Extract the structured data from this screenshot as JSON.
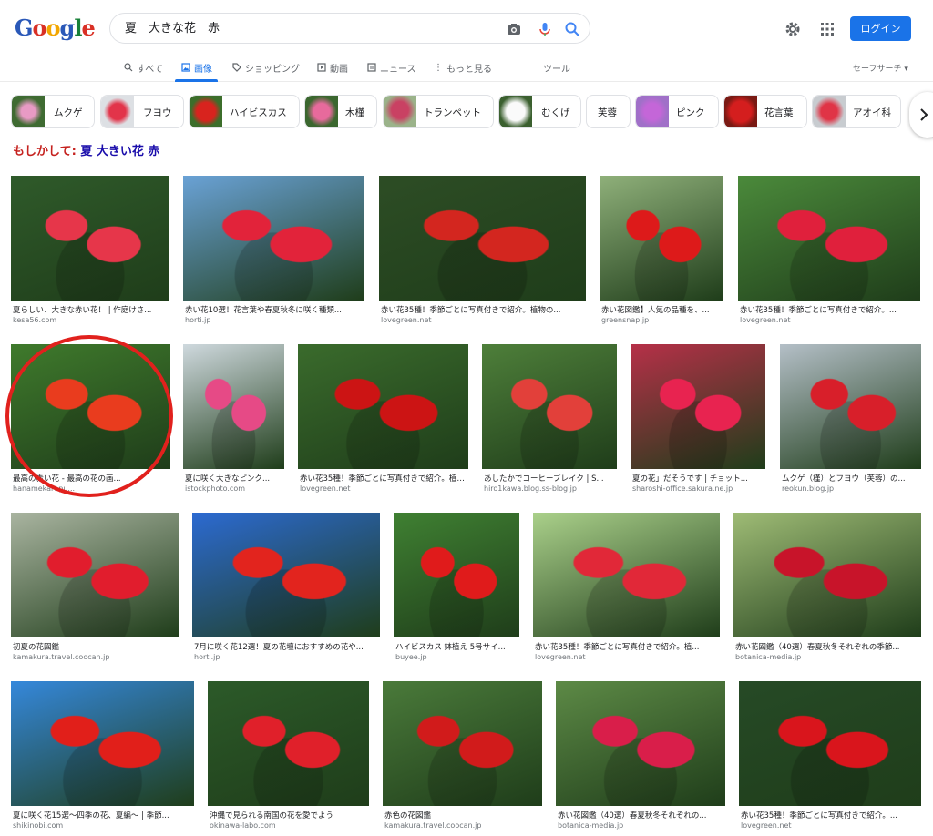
{
  "header": {
    "logo_text": "Google",
    "search_query": "夏　大きな花　赤",
    "login_label": "ログイン"
  },
  "tabs": [
    {
      "label": "すべて",
      "icon": "search-icon"
    },
    {
      "label": "画像",
      "icon": "image-icon",
      "active": true
    },
    {
      "label": "ショッピング",
      "icon": "tag-icon"
    },
    {
      "label": "動画",
      "icon": "play-icon"
    },
    {
      "label": "ニュース",
      "icon": "news-icon"
    },
    {
      "label": "もっと見る",
      "icon": "more-icon"
    }
  ],
  "tools_label": "ツール",
  "safesearch_label": "セーフサーチ ▾",
  "chips": [
    {
      "label": "ムクゲ",
      "has_thumb": true
    },
    {
      "label": "フヨウ",
      "has_thumb": true
    },
    {
      "label": "ハイビスカス",
      "has_thumb": true
    },
    {
      "label": "木槿",
      "has_thumb": true
    },
    {
      "label": "トランペット",
      "has_thumb": true
    },
    {
      "label": "むくげ",
      "has_thumb": true
    },
    {
      "label": "芙蓉",
      "has_thumb": false
    },
    {
      "label": "ピンク",
      "has_thumb": true
    },
    {
      "label": "花言葉",
      "has_thumb": true
    },
    {
      "label": "アオイ科",
      "has_thumb": true
    }
  ],
  "did_you_mean": {
    "prefix": "もしかして: ",
    "suggestion": "夏 大きい花 赤"
  },
  "results": [
    {
      "caption": "夏らしい、大きな赤い花！ | 作庭けさ...",
      "source": "kesa56.com",
      "bg": "#2f5a2a",
      "flower": "#e6364a"
    },
    {
      "caption": "赤い花10選！花言葉や春夏秋冬に咲く種類...",
      "source": "horti.jp",
      "bg": "#6aa2d6",
      "flower": "#e2233a"
    },
    {
      "caption": "赤い花35種！季節ごとに写真付きで紹介。植物の...",
      "source": "lovegreen.net",
      "bg": "#2d4d25",
      "flower": "#d3261f"
    },
    {
      "caption": "赤い花図鑑】人気の品種を、...",
      "source": "greensnap.jp",
      "bg": "#8fb07a",
      "flower": "#dd1a1a"
    },
    {
      "caption": "赤い花35種！季節ごとに写真付きで紹介。...",
      "source": "lovegreen.net",
      "bg": "#4b8a3b",
      "flower": "#e0203c"
    },
    {
      "caption": "最高の赤い花 - 最高の花の画...",
      "source": "hanamekarapu...",
      "bg": "#3f7a2c",
      "flower": "#e93c1e"
    },
    {
      "caption": "夏に咲く大きなピンク...",
      "source": "istockphoto.com",
      "bg": "#cfd9de",
      "flower": "#e64a86"
    },
    {
      "caption": "赤い花35種！季節ごとに写真付きで紹介。植物の...",
      "source": "lovegreen.net",
      "bg": "#3a6b2c",
      "flower": "#cc1414"
    },
    {
      "caption": "あしたかでコーヒーブレイク | S...",
      "source": "hiro1kawa.blog.ss-blog.jp",
      "bg": "#4e7f3a",
      "flower": "#e2403a"
    },
    {
      "caption": "夏の花」だそうです | チョット...",
      "source": "sharoshi-office.sakura.ne.jp",
      "bg": "#b63048",
      "flower": "#e82350"
    },
    {
      "caption": "ムクゲ（槿）とフヨウ（芙蓉）の...",
      "source": "reokun.blog.jp",
      "bg": "#b4bfc7",
      "flower": "#d81f2a"
    },
    {
      "caption": "初夏の花図鑑",
      "source": "kamakura.travel.coocan.jp",
      "bg": "#a9b4a0",
      "flower": "#e11d2d"
    },
    {
      "caption": "7月に咲く花12選！夏の花壇におすすめの花や...",
      "source": "horti.jp",
      "bg": "#2c6ad1",
      "flower": "#e2241e"
    },
    {
      "caption": "ハイビスカス 鉢植え 5号サイ...",
      "source": "buyee.jp",
      "bg": "#3f8032",
      "flower": "#e01b1b"
    },
    {
      "caption": "赤い花35種！季節ごとに写真付きで紹介。植...",
      "source": "lovegreen.net",
      "bg": "#aad08a",
      "flower": "#e12838"
    },
    {
      "caption": "赤い花図鑑（40選）春夏秋冬それぞれの季節...",
      "source": "botanica-media.jp",
      "bg": "#9ebb75",
      "flower": "#c8142a"
    },
    {
      "caption": "夏に咲く花15選〜四季の花、夏編〜 | 季節...",
      "source": "shikinobi.com",
      "bg": "#3588db",
      "flower": "#e11f1a"
    },
    {
      "caption": "沖縄で見られる南国の花を愛でよう",
      "source": "okinawa-labo.com",
      "bg": "#2c5a29",
      "flower": "#e0202a"
    },
    {
      "caption": "赤色の花図鑑",
      "source": "kamakura.travel.coocan.jp",
      "bg": "#4a7a3a",
      "flower": "#d11b1b"
    },
    {
      "caption": "赤い花図鑑（40選）春夏秋冬それぞれの...",
      "source": "botanica-media.jp",
      "bg": "#5d8a46",
      "flower": "#d91e4a"
    },
    {
      "caption": "赤い花35種！季節ごとに写真付きで紹介。...",
      "source": "lovegreen.net",
      "bg": "#264a26",
      "flower": "#d9151c"
    }
  ],
  "colors": {
    "accent": "#1a73e8",
    "highlight_circle": "#e1211d",
    "did_you_mean": "#c5221f"
  }
}
